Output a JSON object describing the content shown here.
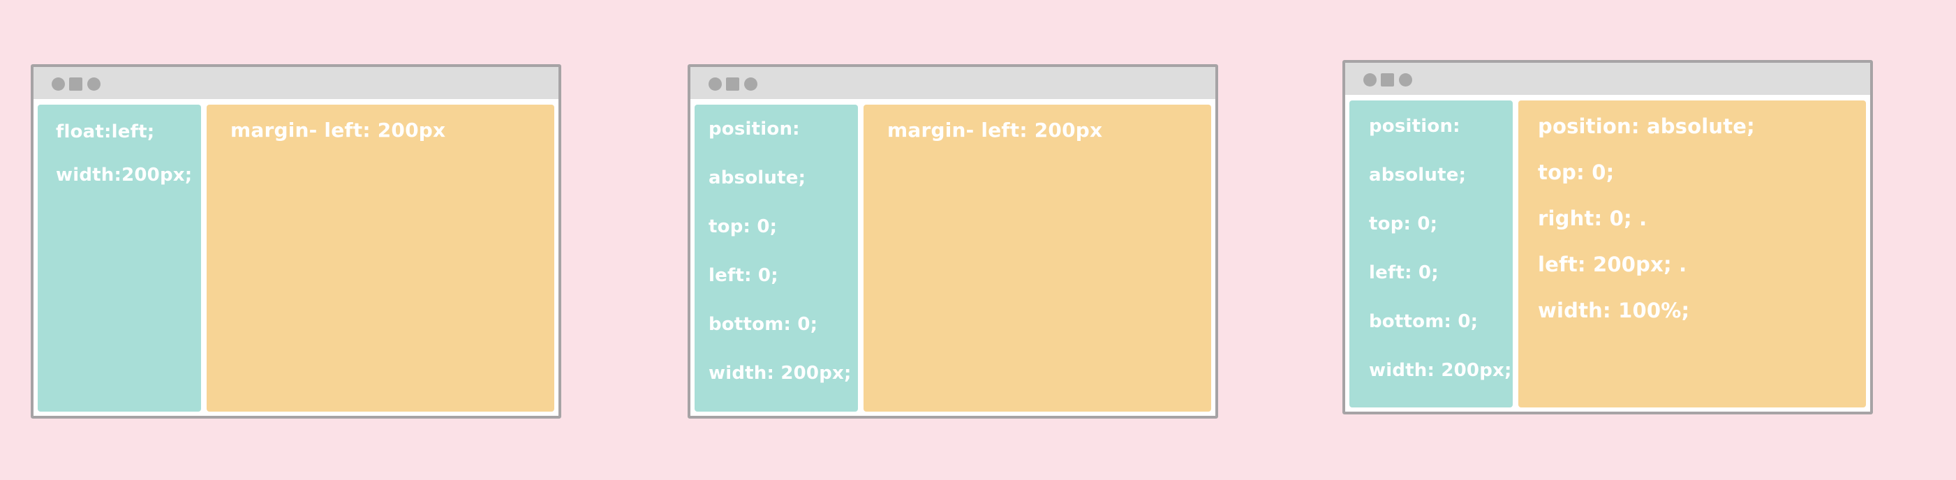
{
  "windows": [
    {
      "sidebar": [
        "float:left;",
        "width:200px;"
      ],
      "main": [
        "margin- left: 200px"
      ]
    },
    {
      "sidebar": [
        "position:",
        "absolute;",
        "top: 0;",
        "left: 0;",
        "bottom: 0;",
        "width: 200px;"
      ],
      "main": [
        "margin- left: 200px"
      ]
    },
    {
      "sidebar": [
        "position:",
        "absolute;",
        "top: 0;",
        "left: 0;",
        "bottom: 0;",
        "width: 200px;"
      ],
      "main": [
        "position: absolute;",
        "top: 0;",
        "right: 0; .",
        "left: 200px; .",
        "width: 100%;"
      ]
    }
  ],
  "colors": {
    "background": "#fbe1e7",
    "window_border": "#a6a3a5",
    "titlebar": "#dddddd",
    "window_controls": "#a8a8a8",
    "sidebar": "#a8ded7",
    "main": "#f7d495",
    "text": "#ffffff"
  },
  "icons": [
    "window-control-circle-icon",
    "window-control-square-icon",
    "window-control-circle-icon"
  ]
}
